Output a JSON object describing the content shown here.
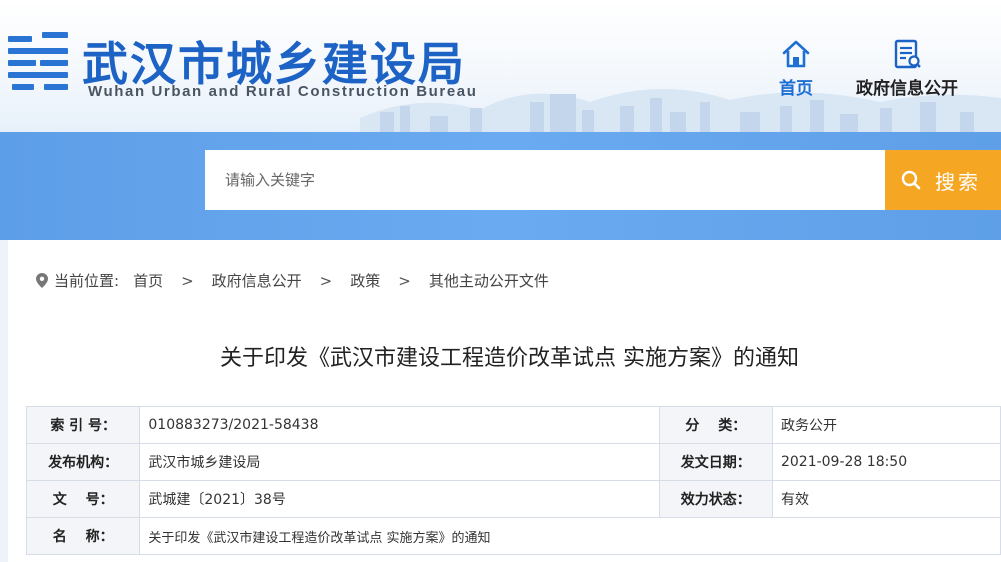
{
  "header": {
    "title": "武汉市城乡建设局",
    "subtitle": "Wuhan Urban and Rural Construction Bureau",
    "nav": [
      {
        "label": "首页",
        "icon": "home-icon"
      },
      {
        "label": "政府信息公开",
        "icon": "document-info-icon"
      }
    ]
  },
  "search": {
    "placeholder": "请输入关键字",
    "button_label": "搜索",
    "icon": "search-icon"
  },
  "breadcrumb": {
    "prefix": "当前位置:",
    "items": [
      "首页",
      "政府信息公开",
      "政策",
      "其他主动公开文件"
    ],
    "separator": ">"
  },
  "document": {
    "title": "关于印发《武汉市建设工程造价改革试点 实施方案》的通知",
    "meta": {
      "index_label": "索 引 号：",
      "index_value": "010883273/2021-58438",
      "category_label": "分　 类：",
      "category_value": "政务公开",
      "publisher_label": "发布机构：",
      "publisher_value": "武汉市城乡建设局",
      "date_label": "发文日期：",
      "date_value": "2021-09-28 18:50",
      "docno_label": "文　 号：",
      "docno_value": "武城建〔2021〕38号",
      "status_label": "效力状态：",
      "status_value": "有效",
      "name_label": "名　 称：",
      "name_value": "关于印发《武汉市建设工程造价改革试点 实施方案》的通知"
    }
  },
  "colors": {
    "brand_blue": "#1d63c5",
    "search_band": "#6aaaf0",
    "search_button": "#f5a623"
  }
}
